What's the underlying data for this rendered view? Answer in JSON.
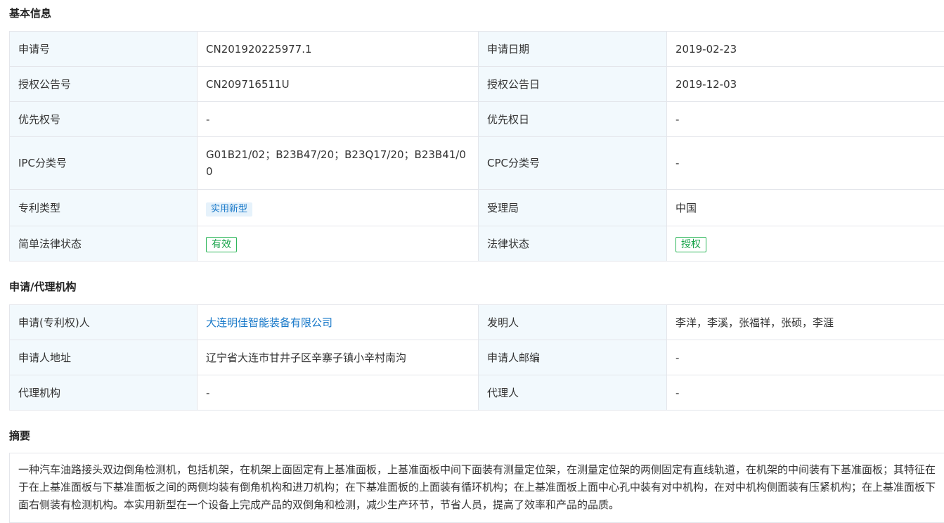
{
  "basic_info": {
    "title": "基本信息",
    "rows": [
      {
        "l1": "申请号",
        "v1": "CN201920225977.1",
        "l2": "申请日期",
        "v2": "2019-02-23"
      },
      {
        "l1": "授权公告号",
        "v1": "CN209716511U",
        "l2": "授权公告日",
        "v2": "2019-12-03"
      },
      {
        "l1": "优先权号",
        "v1": "-",
        "l2": "优先权日",
        "v2": "-"
      },
      {
        "l1": "IPC分类号",
        "v1": "G01B21/02；B23B47/20；B23Q17/20；B23B41/00",
        "l2": "CPC分类号",
        "v2": "-"
      },
      {
        "l1": "专利类型",
        "v1": "实用新型",
        "l2": "受理局",
        "v2": "中国"
      },
      {
        "l1": "简单法律状态",
        "v1": "有效",
        "l2": "法律状态",
        "v2": "授权"
      }
    ]
  },
  "agency": {
    "title": "申请/代理机构",
    "rows": [
      {
        "l1": "申请(专利权)人",
        "v1": "大连明佳智能装备有限公司",
        "l2": "发明人",
        "v2": "李洋，李溪，张福祥，张硕，李涯"
      },
      {
        "l1": "申请人地址",
        "v1": "辽宁省大连市甘井子区辛寨子镇小辛村南沟",
        "l2": "申请人邮编",
        "v2": "-"
      },
      {
        "l1": "代理机构",
        "v1": "-",
        "l2": "代理人",
        "v2": "-"
      }
    ]
  },
  "abstract": {
    "title": "摘要",
    "text": "一种汽车油路接头双边倒角检测机，包括机架，在机架上面固定有上基准面板，上基准面板中间下面装有测量定位架，在测量定位架的两侧固定有直线轨道，在机架的中间装有下基准面板；其特征在于在上基准面板与下基准面板之间的两侧均装有倒角机构和进刀机构；在下基准面板的上面装有循环机构；在上基准面板上面中心孔中装有对中机构，在对中机构侧面装有压紧机构；在上基准面板下面右侧装有检测机构。本实用新型在一个设备上完成产品的双倒角和检测，减少生产环节，节省人员，提高了效率和产品的品质。"
  },
  "colors": {
    "label_bg": "#f2f9fd",
    "border": "#e4e6eb",
    "link": "#1677c8",
    "tag_blue_bg": "#e6f2fb",
    "tag_green": "#1aa44b"
  }
}
